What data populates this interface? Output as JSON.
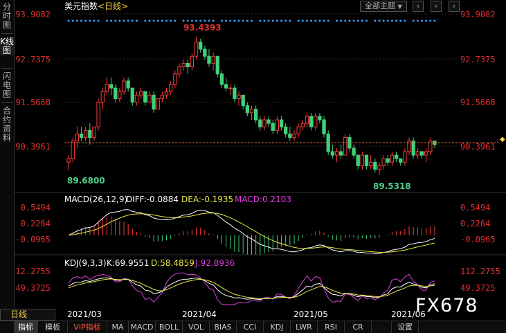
{
  "side_tabs": [
    {
      "label": "分时图",
      "active": false
    },
    {
      "label": "K线图",
      "active": true
    },
    {
      "label": "闪电图",
      "active": false
    },
    {
      "label": "合约资料",
      "active": false
    }
  ],
  "header": {
    "symbol": "美元指数",
    "period": "<日线>",
    "theme_select": "全部主题",
    "theme_arrow": "▼"
  },
  "price_axis": {
    "labels": [
      "93.9082",
      "92.7375",
      "91.5668",
      "90.3961"
    ],
    "last": "90.3961"
  },
  "annotations": {
    "high": "93.4393",
    "low1": "89.6800",
    "low2": "89.5318"
  },
  "macd": {
    "title": "MACD(26,12,9)",
    "diff": "DIFF:-0.0884",
    "dea": "DEA:-0.1935",
    "macd": "MACD:0.2103",
    "axis": [
      "0.5494",
      "0.2264",
      "-0.0965"
    ],
    "colors": {
      "diff": "#ffffff",
      "dea": "#e8e840",
      "macd": "#e040e0"
    }
  },
  "kdj": {
    "title": "KDJ(9,3,3)",
    "k": "K:69.9551",
    "d": "D:58.4859",
    "j": "J:92.8936",
    "axis": [
      "112.2755",
      "49.3725"
    ],
    "colors": {
      "k": "#ffffff",
      "d": "#e8e840",
      "j": "#e040e0"
    }
  },
  "x_axis": {
    "labels": [
      "2021/03",
      "2021/04",
      "2021/05",
      "2021/06"
    ]
  },
  "period_label": "日线",
  "bottom_tabs": [
    "指标",
    "模板",
    "VIP指标",
    "MA",
    "MACD",
    "BOLL",
    "VOL",
    "BIAS",
    "CCI",
    "KDJ",
    "LWR",
    "RSI",
    "CR",
    "",
    "设置"
  ],
  "watermark": "FX678",
  "chart_data": {
    "type": "candlestick",
    "ylim": [
      89.2,
      94.1
    ],
    "ohlc": [
      [
        89.9,
        90.1,
        89.68,
        90.0
      ],
      [
        90.0,
        90.6,
        89.9,
        90.5
      ],
      [
        90.5,
        90.9,
        90.3,
        90.7
      ],
      [
        90.7,
        90.9,
        90.5,
        90.6
      ],
      [
        90.6,
        90.9,
        90.5,
        90.8
      ],
      [
        90.8,
        91.0,
        90.4,
        90.6
      ],
      [
        90.6,
        90.9,
        90.5,
        90.9
      ],
      [
        90.9,
        91.7,
        90.8,
        91.6
      ],
      [
        91.6,
        92.0,
        91.4,
        91.9
      ],
      [
        91.9,
        92.3,
        91.8,
        92.1
      ],
      [
        92.1,
        92.3,
        91.8,
        92.0
      ],
      [
        92.0,
        92.1,
        91.6,
        91.7
      ],
      [
        91.7,
        92.0,
        91.6,
        91.9
      ],
      [
        91.9,
        92.3,
        91.8,
        92.2
      ],
      [
        92.2,
        92.3,
        91.9,
        92.0
      ],
      [
        92.0,
        92.0,
        91.5,
        91.6
      ],
      [
        91.6,
        91.9,
        91.5,
        91.8
      ],
      [
        91.8,
        92.0,
        91.7,
        91.9
      ],
      [
        91.9,
        91.9,
        91.5,
        91.6
      ],
      [
        91.6,
        91.9,
        91.6,
        91.8
      ],
      [
        91.8,
        91.9,
        91.3,
        91.4
      ],
      [
        91.4,
        91.7,
        91.4,
        91.7
      ],
      [
        91.7,
        91.9,
        91.6,
        91.8
      ],
      [
        91.8,
        92.0,
        91.7,
        91.9
      ],
      [
        91.9,
        92.2,
        91.8,
        92.1
      ],
      [
        92.1,
        92.5,
        92.0,
        92.4
      ],
      [
        92.4,
        92.7,
        92.3,
        92.6
      ],
      [
        92.6,
        92.8,
        92.5,
        92.7
      ],
      [
        92.7,
        92.8,
        92.4,
        92.6
      ],
      [
        92.6,
        93.0,
        92.5,
        92.9
      ],
      [
        92.9,
        93.44,
        92.8,
        93.3
      ],
      [
        93.3,
        93.4,
        93.0,
        93.1
      ],
      [
        93.1,
        93.2,
        92.8,
        92.9
      ],
      [
        92.9,
        93.1,
        92.6,
        92.7
      ],
      [
        92.7,
        93.0,
        92.5,
        92.9
      ],
      [
        92.9,
        92.9,
        92.3,
        92.4
      ],
      [
        92.4,
        92.5,
        92.0,
        92.1
      ],
      [
        92.1,
        92.3,
        91.9,
        92.0
      ],
      [
        92.0,
        92.1,
        91.8,
        92.0
      ],
      [
        92.0,
        92.1,
        91.6,
        91.7
      ],
      [
        91.7,
        91.9,
        91.5,
        91.8
      ],
      [
        91.8,
        91.8,
        91.4,
        91.5
      ],
      [
        91.5,
        91.6,
        91.2,
        91.3
      ],
      [
        91.3,
        91.5,
        91.1,
        91.4
      ],
      [
        91.4,
        91.5,
        91.0,
        91.1
      ],
      [
        91.1,
        91.2,
        90.8,
        90.9
      ],
      [
        90.9,
        91.2,
        90.8,
        91.1
      ],
      [
        91.1,
        91.2,
        90.9,
        91.0
      ],
      [
        91.0,
        91.1,
        90.7,
        90.8
      ],
      [
        90.8,
        91.2,
        90.7,
        91.1
      ],
      [
        91.1,
        91.2,
        90.8,
        90.9
      ],
      [
        90.9,
        91.0,
        90.6,
        90.7
      ],
      [
        90.7,
        90.9,
        90.5,
        90.6
      ],
      [
        90.6,
        90.8,
        90.5,
        90.7
      ],
      [
        90.7,
        91.0,
        90.6,
        90.9
      ],
      [
        90.9,
        91.1,
        90.8,
        91.0
      ],
      [
        91.0,
        91.3,
        90.9,
        91.2
      ],
      [
        91.2,
        91.3,
        90.8,
        90.9
      ],
      [
        90.9,
        91.3,
        90.8,
        91.2
      ],
      [
        91.2,
        91.3,
        91.0,
        91.1
      ],
      [
        91.1,
        91.2,
        90.6,
        90.7
      ],
      [
        90.7,
        90.8,
        90.1,
        90.2
      ],
      [
        90.2,
        90.4,
        90.0,
        90.1
      ],
      [
        90.1,
        90.3,
        89.9,
        90.2
      ],
      [
        90.2,
        90.4,
        90.0,
        90.1
      ],
      [
        90.1,
        90.7,
        90.1,
        90.6
      ],
      [
        90.6,
        90.7,
        90.2,
        90.3
      ],
      [
        90.3,
        90.4,
        90.0,
        90.1
      ],
      [
        90.1,
        90.1,
        89.7,
        89.8
      ],
      [
        89.8,
        90.2,
        89.7,
        90.1
      ],
      [
        90.1,
        90.1,
        89.7,
        89.8
      ],
      [
        89.8,
        90.1,
        89.7,
        89.9
      ],
      [
        89.9,
        90.0,
        89.6,
        89.7
      ],
      [
        89.7,
        89.9,
        89.53,
        89.8
      ],
      [
        89.8,
        90.1,
        89.7,
        90.0
      ],
      [
        90.0,
        90.1,
        89.8,
        89.9
      ],
      [
        89.9,
        90.2,
        89.8,
        90.1
      ],
      [
        90.1,
        90.2,
        89.9,
        90.0
      ],
      [
        90.0,
        90.0,
        89.8,
        89.9
      ],
      [
        89.9,
        90.3,
        89.8,
        90.2
      ],
      [
        90.2,
        90.6,
        90.1,
        90.5
      ],
      [
        90.5,
        90.6,
        90.0,
        90.1
      ],
      [
        90.1,
        90.3,
        90.0,
        90.2
      ],
      [
        90.2,
        90.2,
        90.0,
        90.1
      ],
      [
        90.1,
        90.3,
        89.9,
        90.2
      ],
      [
        90.2,
        90.6,
        90.1,
        90.5
      ],
      [
        90.5,
        90.5,
        90.3,
        90.4
      ]
    ]
  }
}
